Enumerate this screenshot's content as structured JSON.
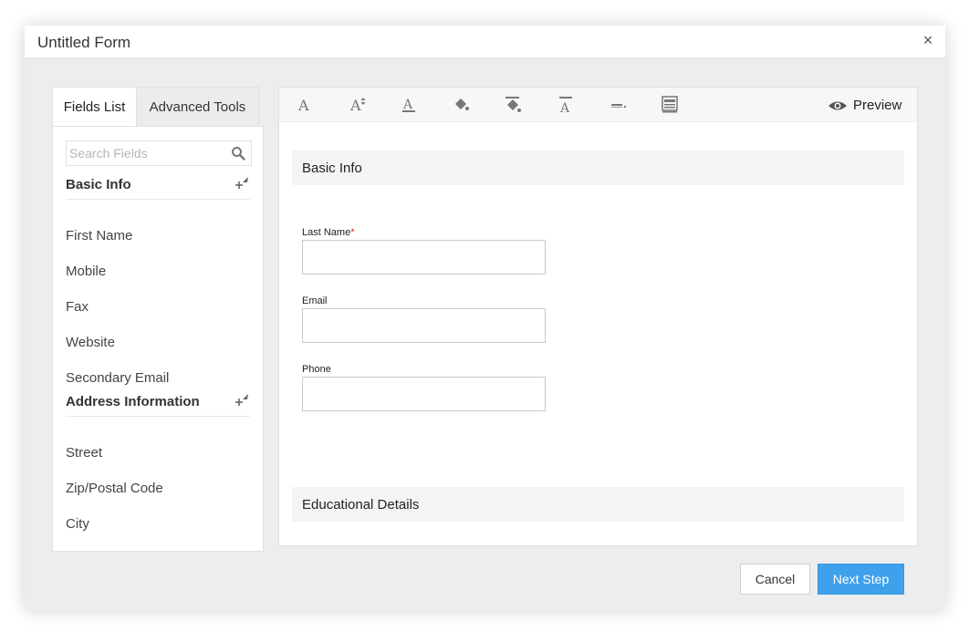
{
  "dialog": {
    "title": "Untitled Form",
    "close_label": "×"
  },
  "left": {
    "tabs": [
      {
        "label": "Fields List",
        "active": true
      },
      {
        "label": "Advanced Tools",
        "active": false
      }
    ],
    "search_placeholder": "Search Fields",
    "sections": [
      {
        "title": "Basic Info",
        "items": [
          "First Name",
          "Mobile",
          "Fax",
          "Website",
          "Secondary Email"
        ]
      },
      {
        "title": "Address Information",
        "items": [
          "Street",
          "Zip/Postal Code",
          "City"
        ]
      }
    ]
  },
  "toolbar": {
    "icons": [
      "font-icon",
      "font-size-icon",
      "font-color-icon",
      "fill-color-icon",
      "background-color-icon",
      "text-align-icon",
      "line-style-icon",
      "layout-icon"
    ],
    "preview_label": "Preview"
  },
  "canvas": {
    "section1": "Basic Info",
    "fields": [
      {
        "label": "Last Name",
        "required": true,
        "value": ""
      },
      {
        "label": "Email",
        "required": false,
        "value": ""
      },
      {
        "label": "Phone",
        "required": false,
        "value": ""
      }
    ],
    "section2": "Educational Details"
  },
  "footer": {
    "cancel_label": "Cancel",
    "next_label": "Next Step"
  },
  "colors": {
    "primary": "#3fa0ec",
    "required": "#e02424"
  }
}
